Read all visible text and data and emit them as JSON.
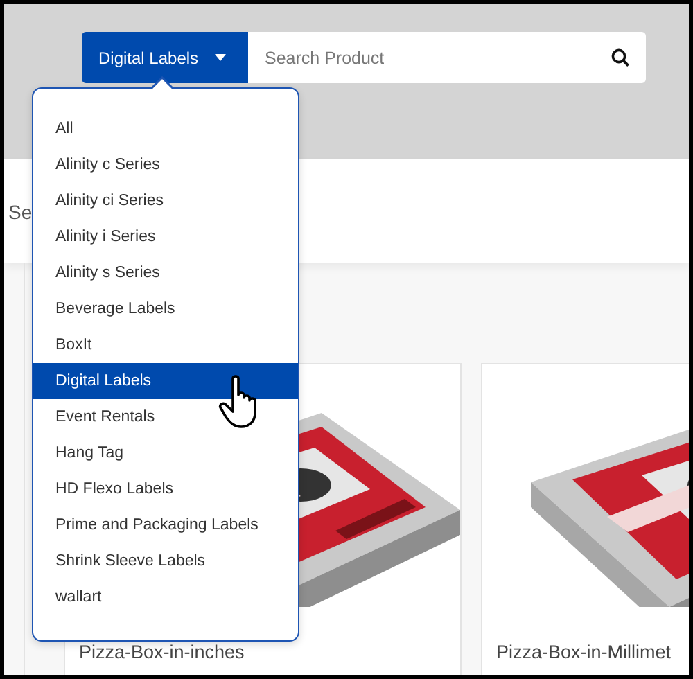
{
  "search": {
    "category_button": "Digital Labels",
    "placeholder": "Search Product"
  },
  "section_heading": "Se",
  "dropdown": {
    "items": [
      {
        "label": "All",
        "selected": false
      },
      {
        "label": "Alinity c Series",
        "selected": false
      },
      {
        "label": "Alinity ci Series",
        "selected": false
      },
      {
        "label": "Alinity i Series",
        "selected": false
      },
      {
        "label": "Alinity s Series",
        "selected": false
      },
      {
        "label": "Beverage Labels",
        "selected": false
      },
      {
        "label": "BoxIt",
        "selected": false
      },
      {
        "label": "Digital Labels",
        "selected": true
      },
      {
        "label": "Event Rentals",
        "selected": false
      },
      {
        "label": "Hang Tag",
        "selected": false
      },
      {
        "label": "HD Flexo Labels",
        "selected": false
      },
      {
        "label": "Prime and Packaging Labels",
        "selected": false
      },
      {
        "label": "Shrink Sleeve Labels",
        "selected": false
      },
      {
        "label": "wallart",
        "selected": false
      }
    ]
  },
  "products": [
    {
      "title": "Pizza-Box-in-inches"
    },
    {
      "title": "Pizza-Box-in-Millimet"
    }
  ]
}
